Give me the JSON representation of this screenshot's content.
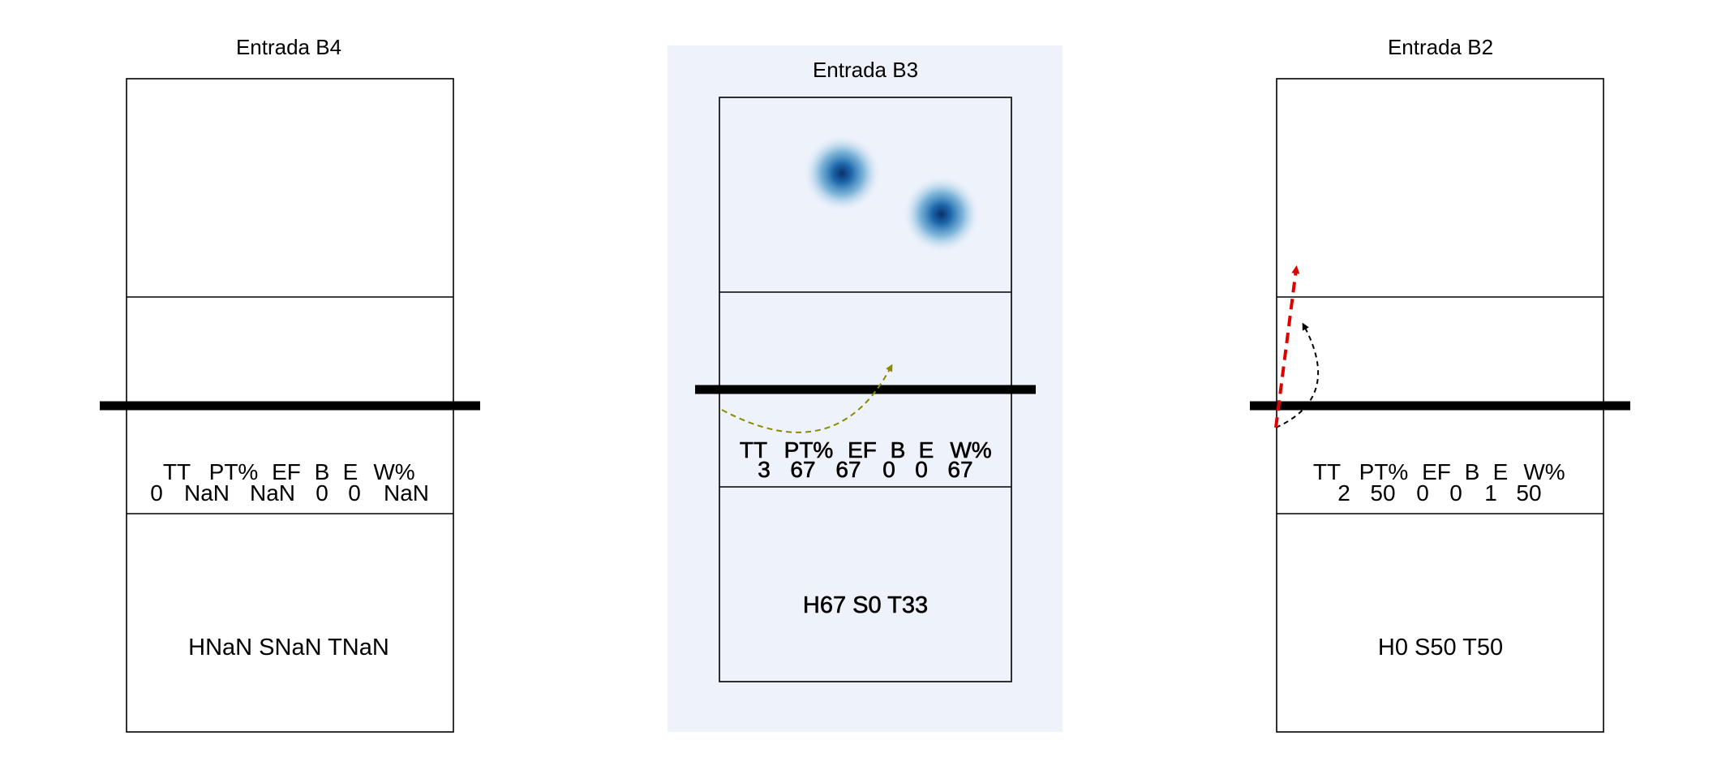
{
  "chart_data": [
    {
      "type": "heatmap",
      "title": "Entrada B4",
      "highlighted": false,
      "stats_header": [
        "TT",
        "PT%",
        "EF",
        "B",
        "E",
        "W%"
      ],
      "stats_values": [
        "0",
        "NaN",
        "NaN",
        "0",
        "0",
        "NaN"
      ],
      "summary": "HNaN SNaN TNaN",
      "trajectories": [],
      "heat_points": []
    },
    {
      "type": "heatmap",
      "title": "Entrada B3",
      "highlighted": true,
      "background": "#eef2fb",
      "stats_header": [
        "TT",
        "PT%",
        "EF",
        "B",
        "E",
        "W%"
      ],
      "stats_values": [
        "3",
        "67",
        "67",
        "0",
        "0",
        "67"
      ],
      "summary": "H67 S0 T33",
      "trajectories": [
        {
          "color": "#8b8b00",
          "style": "dashed-thin"
        }
      ],
      "heat_points": [
        {
          "court_x": 0.42,
          "court_y": 0.13
        },
        {
          "court_x": 0.76,
          "court_y": 0.2
        }
      ]
    },
    {
      "type": "heatmap",
      "title": "Entrada B2",
      "highlighted": false,
      "stats_header": [
        "TT",
        "PT%",
        "EF",
        "B",
        "E",
        "W%"
      ],
      "stats_values": [
        "2",
        "50",
        "0",
        "0",
        "1",
        "50"
      ],
      "summary": "H0 S50 T50",
      "trajectories": [
        {
          "color": "#e00000",
          "style": "dashed-thick"
        },
        {
          "color": "#000000",
          "style": "dashed-thin"
        }
      ],
      "heat_points": []
    }
  ]
}
